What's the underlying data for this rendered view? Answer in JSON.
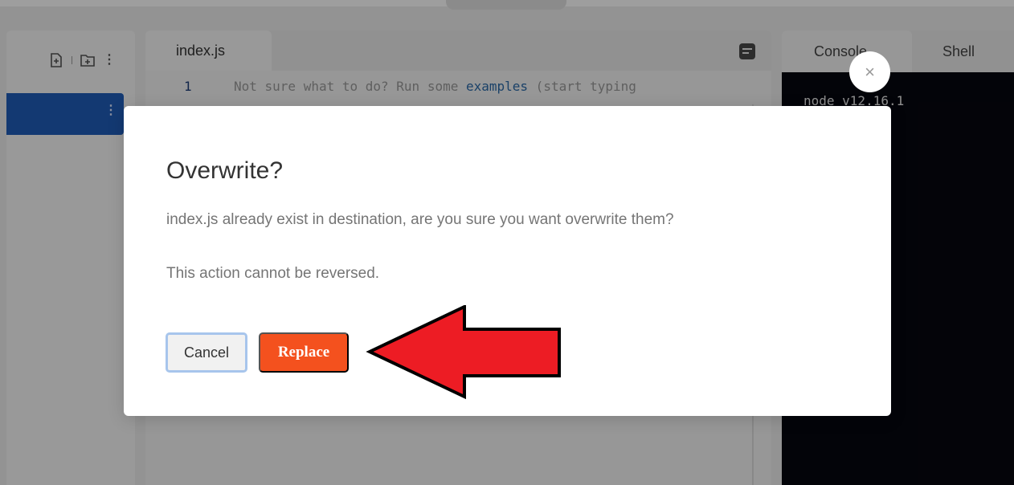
{
  "editor": {
    "tab_label": "index.js",
    "line_number": "1",
    "line_text_before": "Not sure what to do? Run some ",
    "line_text_link": "examples",
    "line_text_after": " (start typing"
  },
  "console": {
    "tab_console": "Console",
    "tab_shell": "Shell",
    "output": "node v12.16.1"
  },
  "modal": {
    "title": "Overwrite?",
    "message": "index.js already exist in destination, are you sure you want overwrite them?",
    "note": "This action cannot be reversed.",
    "cancel_label": "Cancel",
    "replace_label": "Replace",
    "close_glyph": "×"
  },
  "colors": {
    "accent_file_row": "#1f5db8",
    "replace_button": "#f4511e",
    "annotation_arrow": "#ed1c24",
    "console_bg": "#06070f"
  },
  "icons": [
    "new-file-icon",
    "new-folder-icon",
    "kebab-menu-icon",
    "outline-icon",
    "close-icon",
    "annotation-arrow-icon"
  ]
}
